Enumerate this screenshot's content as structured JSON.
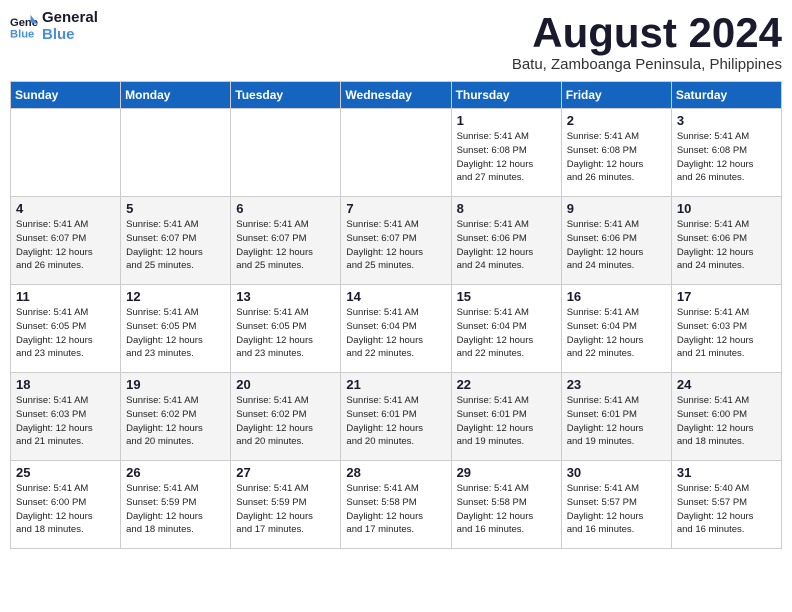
{
  "logo": {
    "line1": "General",
    "line2": "Blue"
  },
  "title": "August 2024",
  "subtitle": "Batu, Zamboanga Peninsula, Philippines",
  "days_of_week": [
    "Sunday",
    "Monday",
    "Tuesday",
    "Wednesday",
    "Thursday",
    "Friday",
    "Saturday"
  ],
  "weeks": [
    [
      {
        "day": "",
        "info": ""
      },
      {
        "day": "",
        "info": ""
      },
      {
        "day": "",
        "info": ""
      },
      {
        "day": "",
        "info": ""
      },
      {
        "day": "1",
        "info": "Sunrise: 5:41 AM\nSunset: 6:08 PM\nDaylight: 12 hours\nand 27 minutes."
      },
      {
        "day": "2",
        "info": "Sunrise: 5:41 AM\nSunset: 6:08 PM\nDaylight: 12 hours\nand 26 minutes."
      },
      {
        "day": "3",
        "info": "Sunrise: 5:41 AM\nSunset: 6:08 PM\nDaylight: 12 hours\nand 26 minutes."
      }
    ],
    [
      {
        "day": "4",
        "info": "Sunrise: 5:41 AM\nSunset: 6:07 PM\nDaylight: 12 hours\nand 26 minutes."
      },
      {
        "day": "5",
        "info": "Sunrise: 5:41 AM\nSunset: 6:07 PM\nDaylight: 12 hours\nand 25 minutes."
      },
      {
        "day": "6",
        "info": "Sunrise: 5:41 AM\nSunset: 6:07 PM\nDaylight: 12 hours\nand 25 minutes."
      },
      {
        "day": "7",
        "info": "Sunrise: 5:41 AM\nSunset: 6:07 PM\nDaylight: 12 hours\nand 25 minutes."
      },
      {
        "day": "8",
        "info": "Sunrise: 5:41 AM\nSunset: 6:06 PM\nDaylight: 12 hours\nand 24 minutes."
      },
      {
        "day": "9",
        "info": "Sunrise: 5:41 AM\nSunset: 6:06 PM\nDaylight: 12 hours\nand 24 minutes."
      },
      {
        "day": "10",
        "info": "Sunrise: 5:41 AM\nSunset: 6:06 PM\nDaylight: 12 hours\nand 24 minutes."
      }
    ],
    [
      {
        "day": "11",
        "info": "Sunrise: 5:41 AM\nSunset: 6:05 PM\nDaylight: 12 hours\nand 23 minutes."
      },
      {
        "day": "12",
        "info": "Sunrise: 5:41 AM\nSunset: 6:05 PM\nDaylight: 12 hours\nand 23 minutes."
      },
      {
        "day": "13",
        "info": "Sunrise: 5:41 AM\nSunset: 6:05 PM\nDaylight: 12 hours\nand 23 minutes."
      },
      {
        "day": "14",
        "info": "Sunrise: 5:41 AM\nSunset: 6:04 PM\nDaylight: 12 hours\nand 22 minutes."
      },
      {
        "day": "15",
        "info": "Sunrise: 5:41 AM\nSunset: 6:04 PM\nDaylight: 12 hours\nand 22 minutes."
      },
      {
        "day": "16",
        "info": "Sunrise: 5:41 AM\nSunset: 6:04 PM\nDaylight: 12 hours\nand 22 minutes."
      },
      {
        "day": "17",
        "info": "Sunrise: 5:41 AM\nSunset: 6:03 PM\nDaylight: 12 hours\nand 21 minutes."
      }
    ],
    [
      {
        "day": "18",
        "info": "Sunrise: 5:41 AM\nSunset: 6:03 PM\nDaylight: 12 hours\nand 21 minutes."
      },
      {
        "day": "19",
        "info": "Sunrise: 5:41 AM\nSunset: 6:02 PM\nDaylight: 12 hours\nand 20 minutes."
      },
      {
        "day": "20",
        "info": "Sunrise: 5:41 AM\nSunset: 6:02 PM\nDaylight: 12 hours\nand 20 minutes."
      },
      {
        "day": "21",
        "info": "Sunrise: 5:41 AM\nSunset: 6:01 PM\nDaylight: 12 hours\nand 20 minutes."
      },
      {
        "day": "22",
        "info": "Sunrise: 5:41 AM\nSunset: 6:01 PM\nDaylight: 12 hours\nand 19 minutes."
      },
      {
        "day": "23",
        "info": "Sunrise: 5:41 AM\nSunset: 6:01 PM\nDaylight: 12 hours\nand 19 minutes."
      },
      {
        "day": "24",
        "info": "Sunrise: 5:41 AM\nSunset: 6:00 PM\nDaylight: 12 hours\nand 18 minutes."
      }
    ],
    [
      {
        "day": "25",
        "info": "Sunrise: 5:41 AM\nSunset: 6:00 PM\nDaylight: 12 hours\nand 18 minutes."
      },
      {
        "day": "26",
        "info": "Sunrise: 5:41 AM\nSunset: 5:59 PM\nDaylight: 12 hours\nand 18 minutes."
      },
      {
        "day": "27",
        "info": "Sunrise: 5:41 AM\nSunset: 5:59 PM\nDaylight: 12 hours\nand 17 minutes."
      },
      {
        "day": "28",
        "info": "Sunrise: 5:41 AM\nSunset: 5:58 PM\nDaylight: 12 hours\nand 17 minutes."
      },
      {
        "day": "29",
        "info": "Sunrise: 5:41 AM\nSunset: 5:58 PM\nDaylight: 12 hours\nand 16 minutes."
      },
      {
        "day": "30",
        "info": "Sunrise: 5:41 AM\nSunset: 5:57 PM\nDaylight: 12 hours\nand 16 minutes."
      },
      {
        "day": "31",
        "info": "Sunrise: 5:40 AM\nSunset: 5:57 PM\nDaylight: 12 hours\nand 16 minutes."
      }
    ]
  ]
}
